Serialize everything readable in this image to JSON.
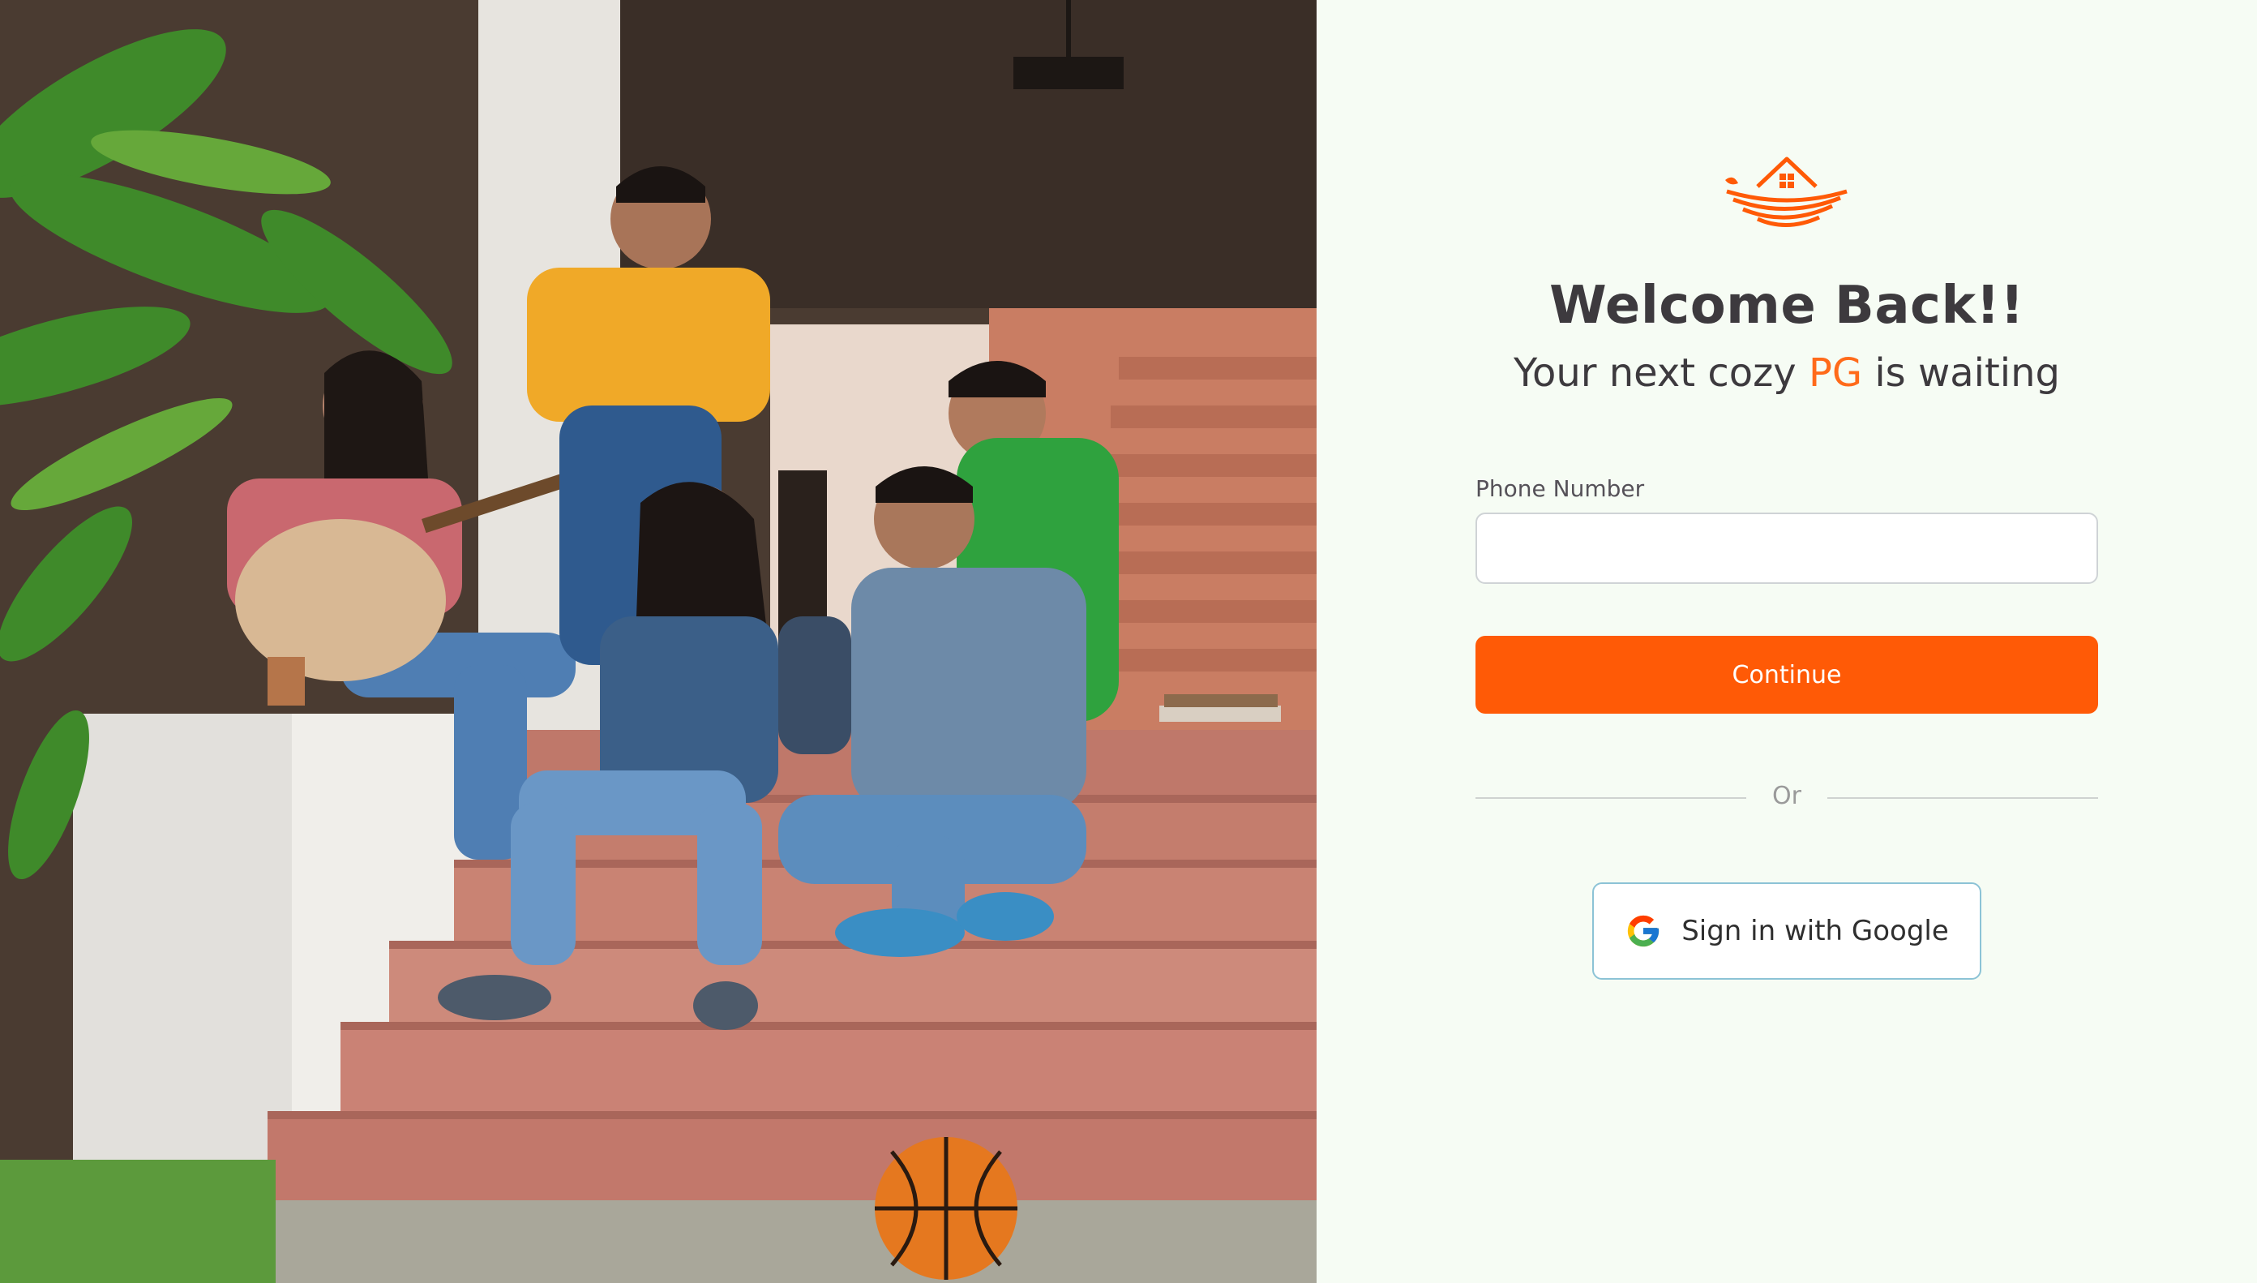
{
  "brand": {
    "accent_color": "#ff5a06",
    "logo_icon": "house-nest-logo-icon"
  },
  "hero": {
    "image_description_icon": "students-on-steps-photo"
  },
  "login": {
    "title": "Welcome Back!!",
    "subtitle_before": "Your next cozy ",
    "subtitle_accent": "PG",
    "subtitle_after": " is waiting",
    "phone_label": "Phone Number",
    "phone_value": "",
    "continue_label": "Continue",
    "divider_text": "Or",
    "google_label": "Sign in with Google",
    "google_icon": "google-g-icon"
  }
}
